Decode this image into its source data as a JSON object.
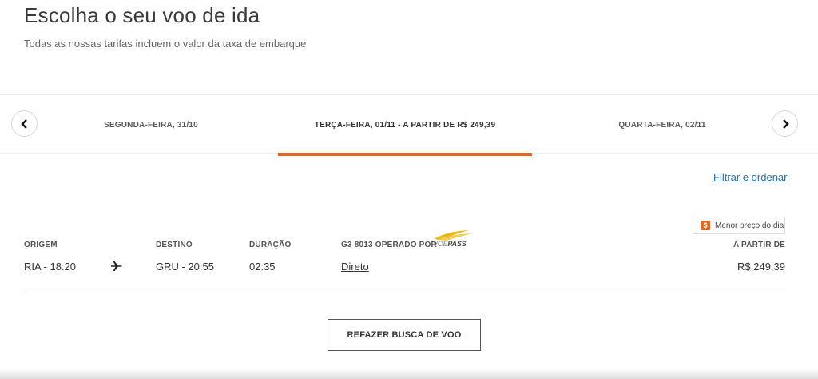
{
  "header": {
    "title": "Escolha o seu voo de ida",
    "subtitle": "Todas as nossas tarifas incluem o valor da taxa de embarque"
  },
  "date_nav": {
    "prev_tab": "SEGUNDA-FEIRA, 31/10",
    "current_tab": "TERÇA-FEIRA, 01/11 - A PARTIR DE R$ 249,39",
    "next_tab": "QUARTA-FEIRA, 02/11",
    "accent_color": "#e8651e"
  },
  "filter": {
    "label": "Filtrar e ordenar"
  },
  "flight": {
    "badge": "Menor preço do dia",
    "labels": {
      "origin": "ORIGEM",
      "destination": "DESTINO",
      "duration": "DURAÇÃO",
      "operator": "G3 8013 OPERADO POR",
      "from": "A PARTIR DE"
    },
    "origin": "RIA - 18:20",
    "destination": "GRU - 20:55",
    "duration": "02:35",
    "stops": "Direto",
    "price": "R$ 249,39",
    "airline_logo": {
      "light": "VOE",
      "bold": "PASS"
    }
  },
  "actions": {
    "redo_search": "REFAZER BUSCA DE VOO"
  },
  "icons": {
    "prev": "chevron-left-icon",
    "next": "chevron-right-icon",
    "plane": "airplane-icon",
    "badge": "dollar-icon"
  }
}
